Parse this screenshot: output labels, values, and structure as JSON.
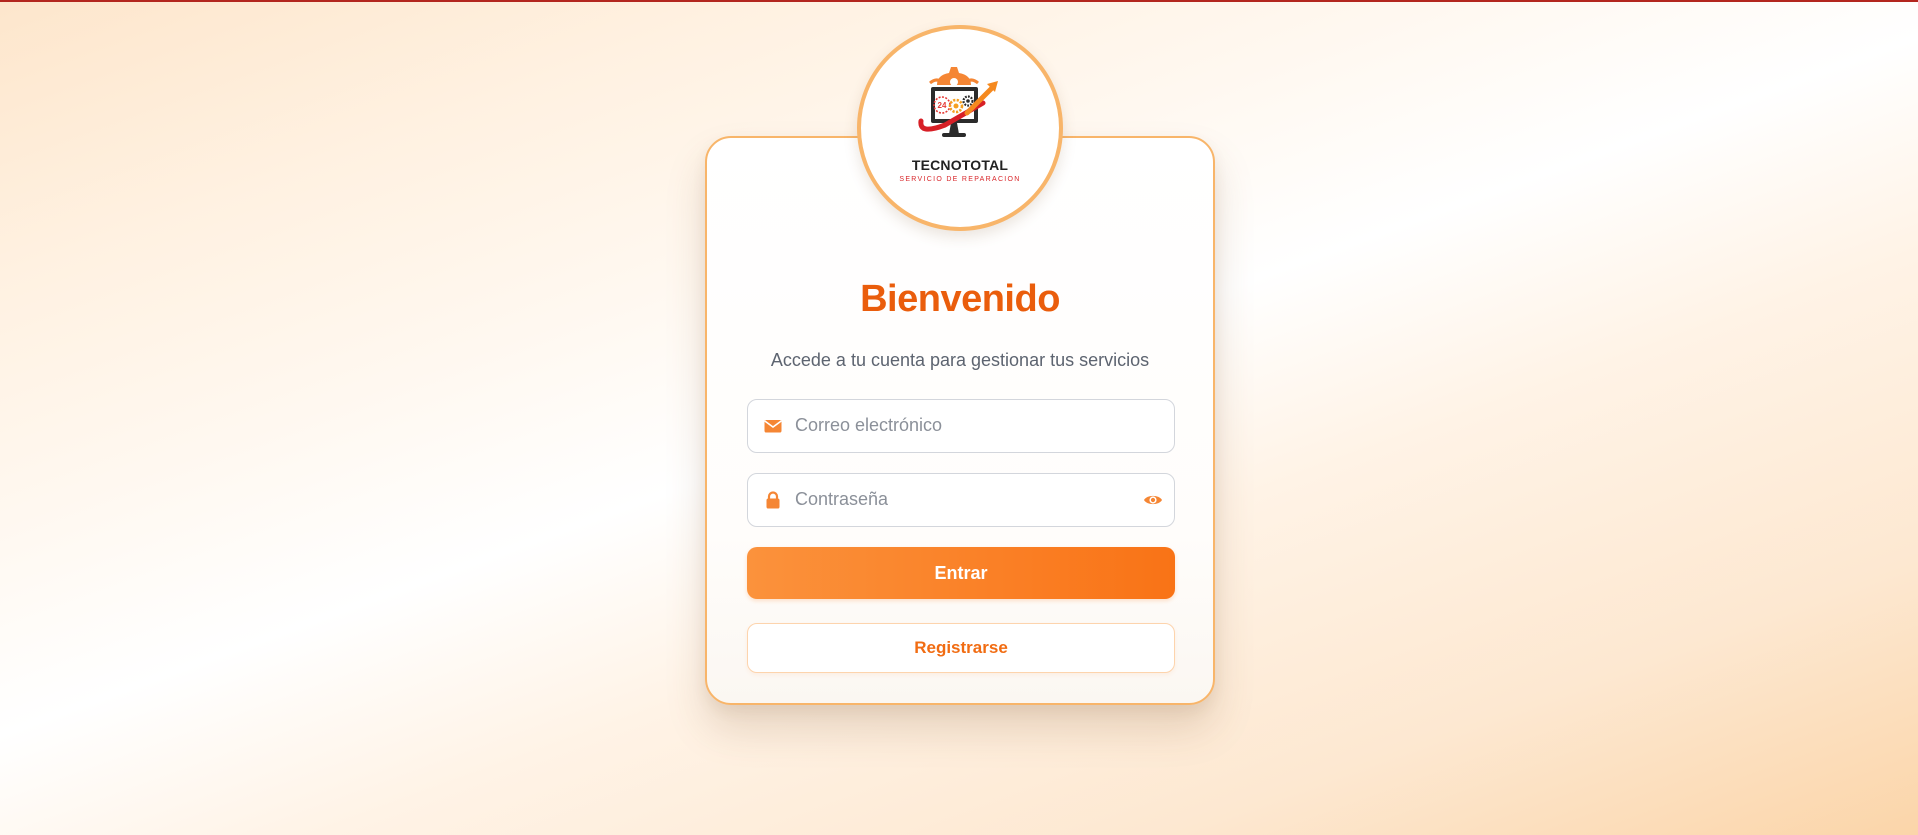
{
  "brand": {
    "name": "TECNOTOTAL",
    "tagline": "SERVICIO DE REPARACION",
    "logo_badge": "24"
  },
  "login": {
    "title": "Bienvenido",
    "subtitle": "Accede a tu cuenta para gestionar tus servicios",
    "email_placeholder": "Correo electrónico",
    "email_icon": "envelope-icon",
    "password_placeholder": "Contraseña",
    "password_icon": "lock-icon",
    "toggle_icon": "eye-icon",
    "submit_label": "Entrar",
    "register_label": "Registrarse"
  },
  "colors": {
    "accent": "#f97316",
    "title": "#ea5d0c",
    "border": "#f8b56a",
    "top_line": "#b3261e"
  }
}
